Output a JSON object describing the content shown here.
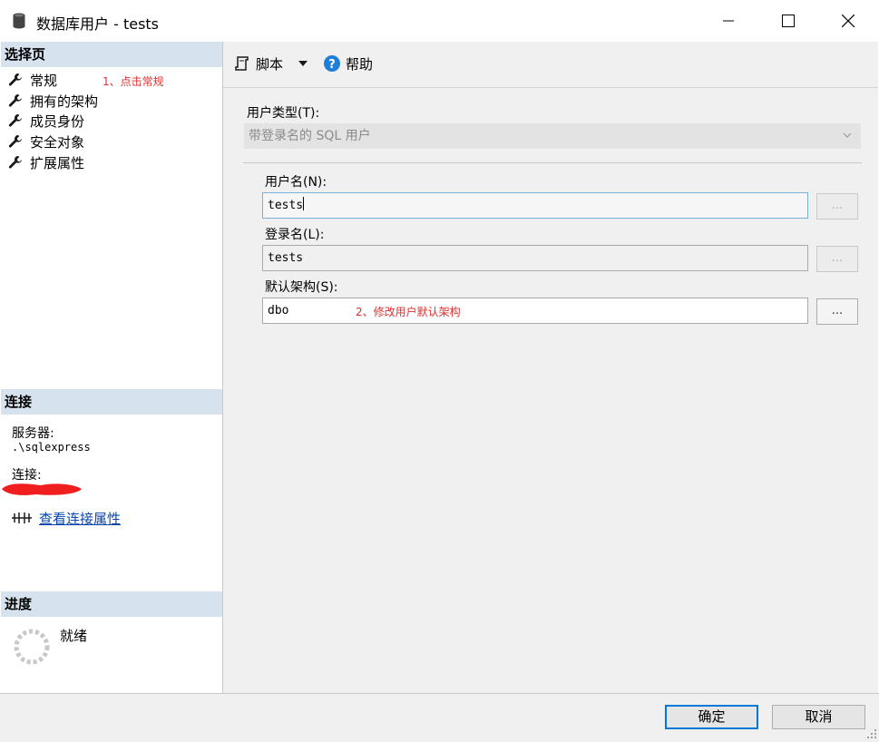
{
  "window": {
    "title": "数据库用户 - tests",
    "controls": {
      "minimize": "—",
      "maximize": "☐",
      "close": "✕"
    }
  },
  "left_panel": {
    "select_page_header": "选择页",
    "pages": [
      {
        "label": "常规",
        "icon": "wrench-icon"
      },
      {
        "label": "拥有的架构",
        "icon": "wrench-icon"
      },
      {
        "label": "成员身份",
        "icon": "wrench-icon"
      },
      {
        "label": "安全对象",
        "icon": "wrench-icon"
      },
      {
        "label": "扩展属性",
        "icon": "wrench-icon"
      }
    ],
    "annotation_1": "1、点击常规",
    "connection_header": "连接",
    "server_label": "服务器:",
    "server_value": ".\\sqlexpress",
    "connection_label": "连接:",
    "view_properties_link": "查看连接属性",
    "progress_header": "进度",
    "progress_status": "就绪"
  },
  "toolbar": {
    "script_label": "脚本",
    "help_label": "帮助"
  },
  "form": {
    "user_type_label": "用户类型(T):",
    "user_type_value": "带登录名的 SQL 用户",
    "user_name_label": "用户名(N):",
    "user_name_value": "tests",
    "login_name_label": "登录名(L):",
    "login_name_value": "tests",
    "default_schema_label": "默认架构(S):",
    "default_schema_value": "dbo",
    "ellipsis_label": "...",
    "annotation_2": "2、修改用户默认架构"
  },
  "footer": {
    "ok_label": "确定",
    "cancel_label": "取消"
  },
  "colors": {
    "section_header_bg": "#d6e3ef",
    "annotation_red": "#e03030",
    "link_blue": "#0645ad",
    "focus_blue": "#0078d7",
    "help_icon_blue": "#1e7fd8"
  }
}
